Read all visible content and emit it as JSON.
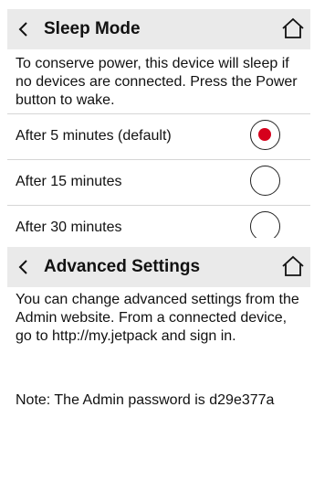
{
  "sleep_mode": {
    "title": "Sleep Mode",
    "description": "To conserve power, this device will sleep if no devices are connected. Press the Power button to wake.",
    "options": [
      {
        "label": "After 5 minutes (default)",
        "selected": true
      },
      {
        "label": "After 15 minutes",
        "selected": false
      },
      {
        "label": "After 30 minutes",
        "selected": false
      }
    ]
  },
  "advanced_settings": {
    "title": "Advanced Settings",
    "description": "You can change advanced settings from the Admin website. From a connected device, go to http://my.jetpack and sign in.",
    "note": "Note: The Admin password is d29e377a"
  },
  "icons": {
    "back": "chevron-left-icon",
    "home": "home-icon"
  },
  "colors": {
    "header_bg": "#eaeaea",
    "radio_selected": "#d6001c"
  }
}
